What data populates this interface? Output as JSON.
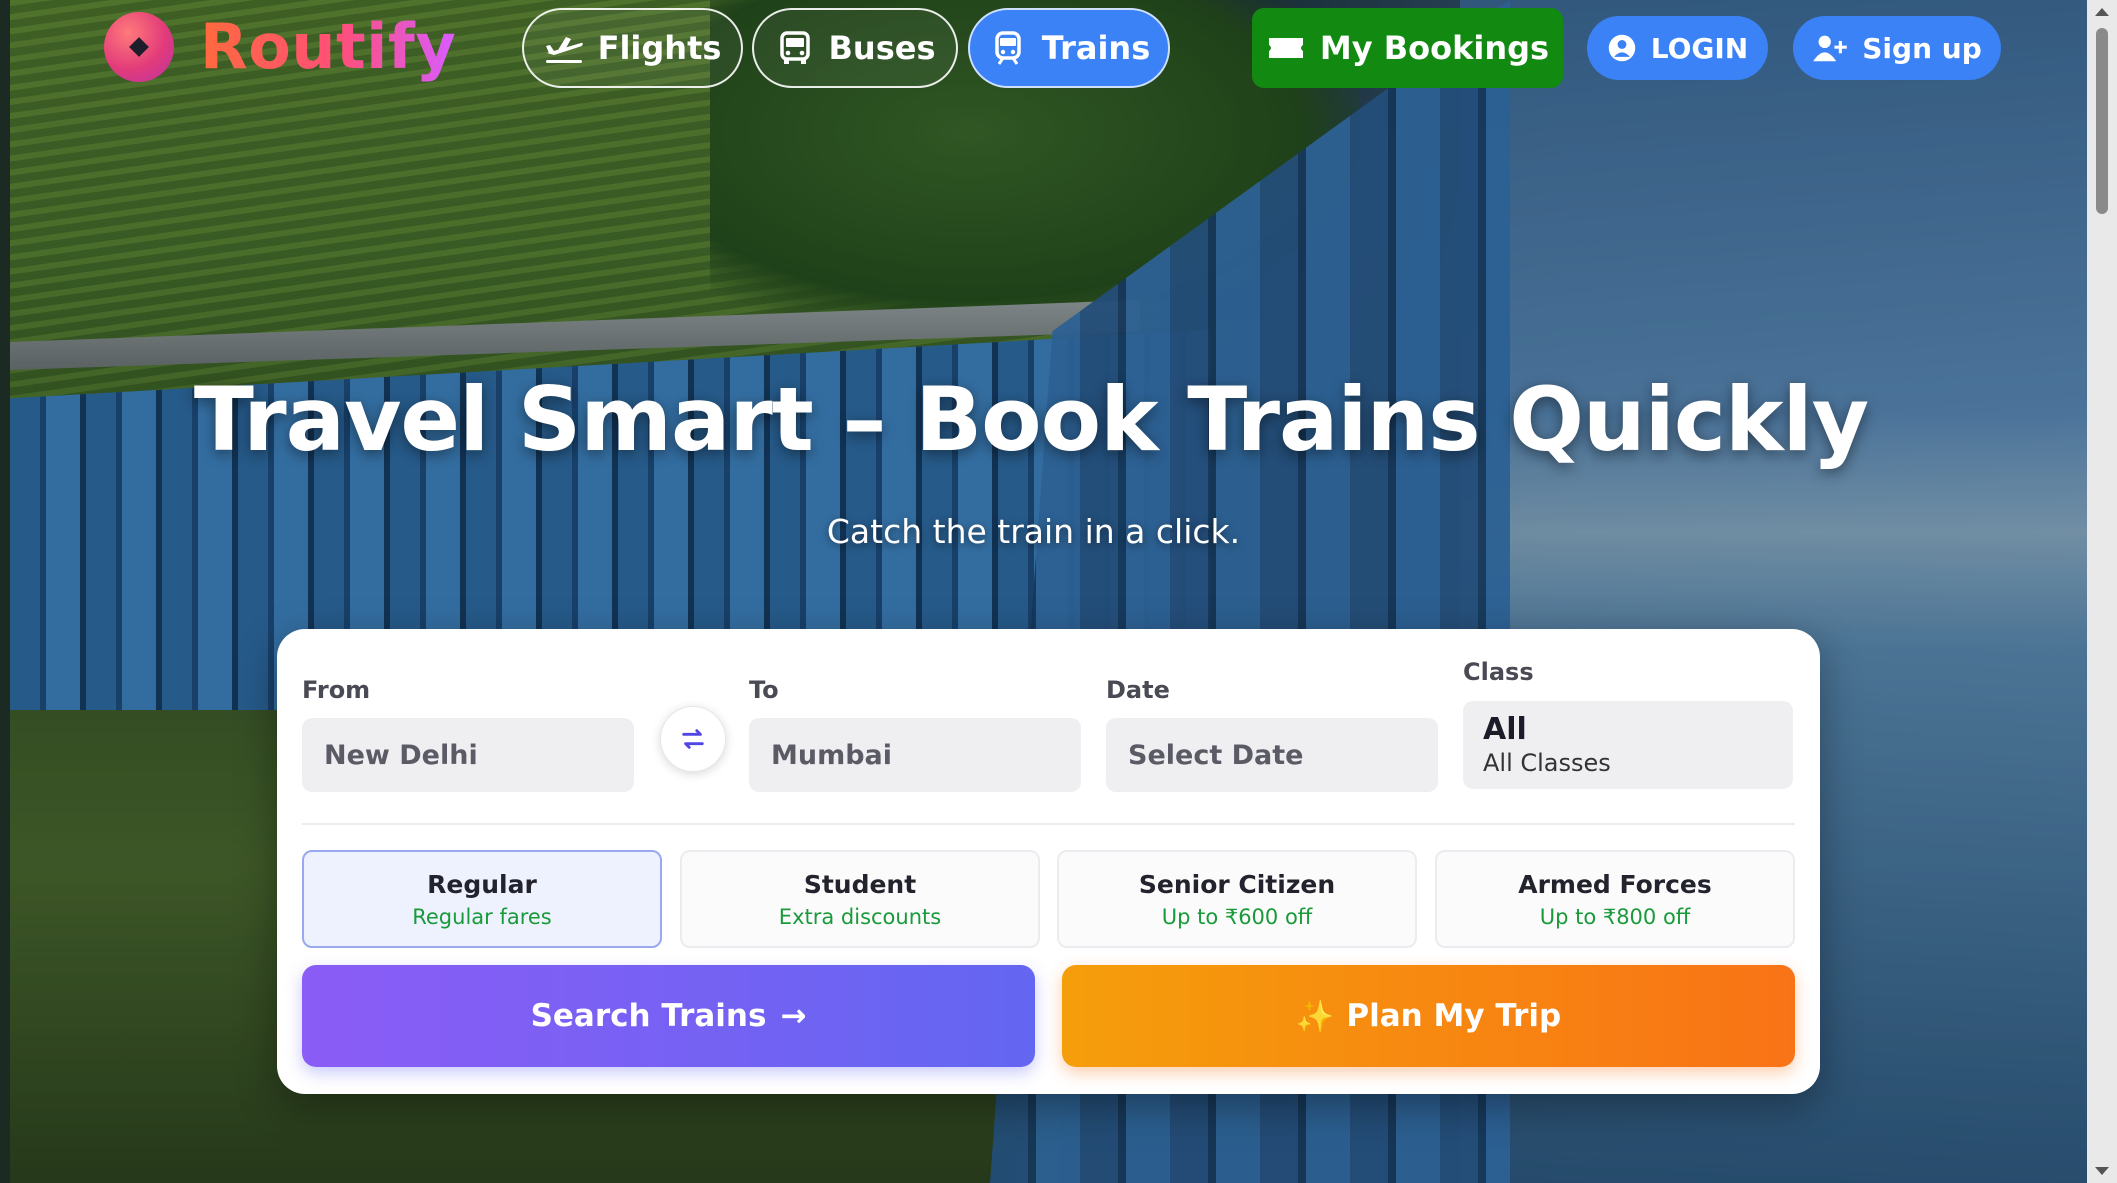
{
  "brand": {
    "name": "Routify"
  },
  "nav": {
    "flights": "Flights",
    "buses": "Buses",
    "trains": "Trains",
    "bookings": "My Bookings",
    "login": "LOGIN",
    "signup": "Sign up"
  },
  "hero": {
    "title": "Travel Smart – Book Trains Quickly",
    "subtitle": "Catch the train in a click."
  },
  "search": {
    "from_label": "From",
    "from_value": "New Delhi",
    "to_label": "To",
    "to_value": "Mumbai",
    "date_label": "Date",
    "date_placeholder": "Select Date",
    "class_label": "Class",
    "class_value": "All",
    "class_sub": "All Classes"
  },
  "fares": [
    {
      "title": "Regular",
      "sub": "Regular fares",
      "selected": true
    },
    {
      "title": "Student",
      "sub": "Extra discounts",
      "selected": false
    },
    {
      "title": "Senior Citizen",
      "sub": "Up to ₹600 off",
      "selected": false
    },
    {
      "title": "Armed Forces",
      "sub": "Up to ₹800 off",
      "selected": false
    }
  ],
  "actions": {
    "search_label": "Search Trains",
    "plan_label": "Plan My Trip",
    "plan_icon": "✨",
    "search_icon": "→"
  },
  "colors": {
    "accent_blue": "#3b82f6",
    "bookings_green": "#128a12",
    "search_gradient": "#8b5cf6",
    "plan_gradient": "#f97316",
    "discount_green": "#1a9a3a"
  }
}
